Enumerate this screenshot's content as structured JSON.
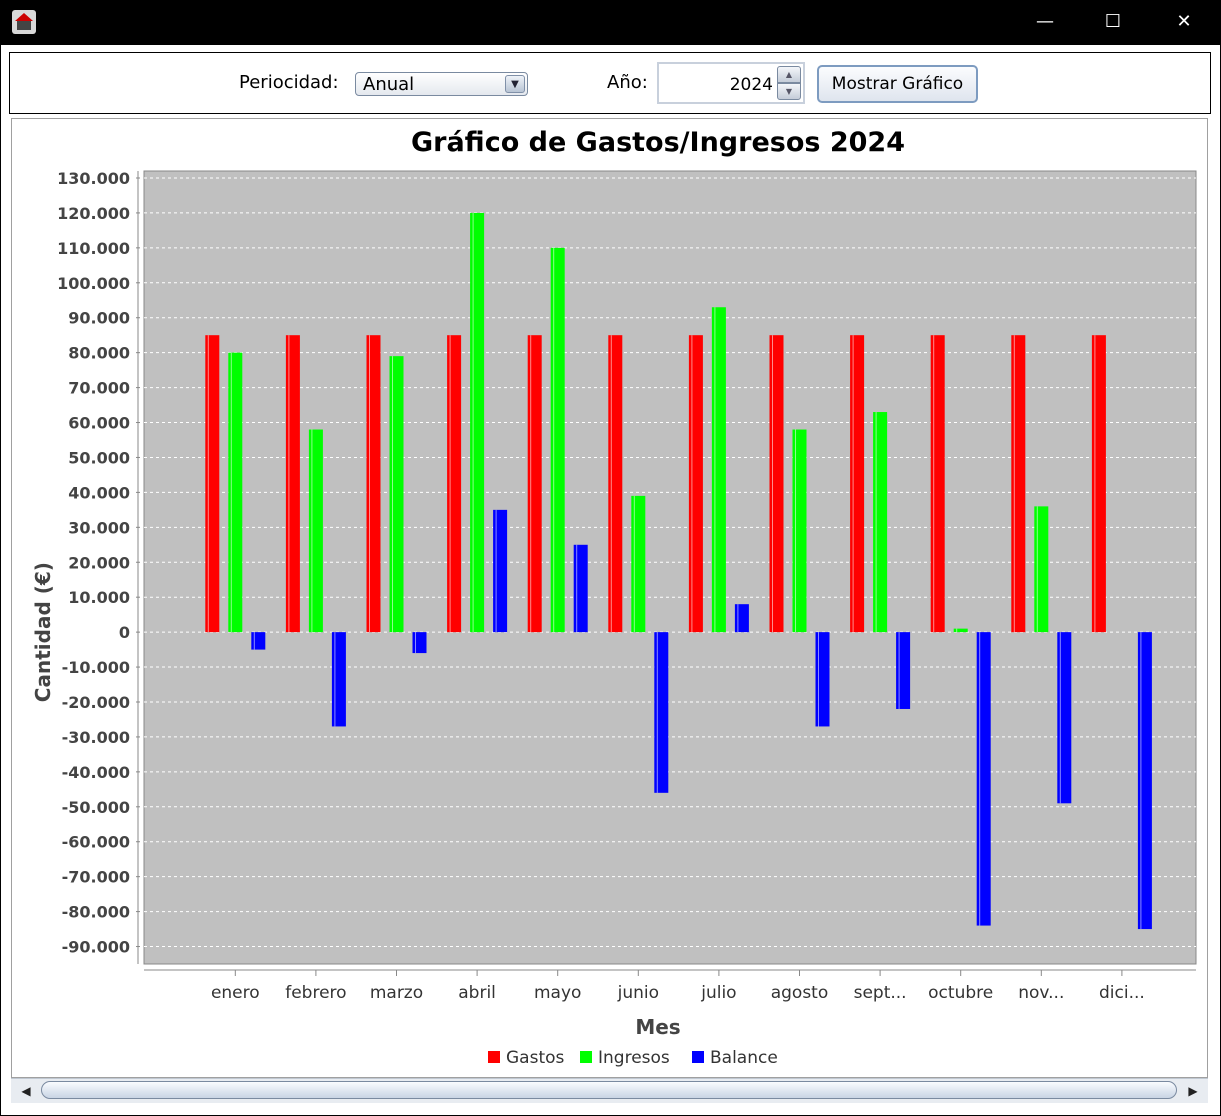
{
  "window": {
    "minimize_glyph": "—",
    "maximize_glyph": "☐",
    "close_glyph": "✕",
    "icon": "app-icon"
  },
  "toolbar": {
    "periodicidad_label": "Periocidad:",
    "periodicidad_value": "Anual",
    "anio_label": "Año:",
    "anio_value": "2024",
    "show_button": "Mostrar Gráfico"
  },
  "chart_data": {
    "type": "bar",
    "title": "Gráfico de Gastos/Ingresos 2024",
    "xlabel": "Mes",
    "ylabel": "Cantidad (€)",
    "ylim": [
      -95000,
      132000
    ],
    "yticks": [
      130000,
      120000,
      110000,
      100000,
      90000,
      80000,
      70000,
      60000,
      50000,
      40000,
      30000,
      20000,
      10000,
      0,
      -10000,
      -20000,
      -30000,
      -40000,
      -50000,
      -60000,
      -70000,
      -80000,
      -90000
    ],
    "ytick_labels": [
      "130.000",
      "120.000",
      "110.000",
      "100.000",
      "90.000",
      "80.000",
      "70.000",
      "60.000",
      "50.000",
      "40.000",
      "30.000",
      "20.000",
      "10.000",
      "0",
      "-10.000",
      "-20.000",
      "-30.000",
      "-40.000",
      "-50.000",
      "-60.000",
      "-70.000",
      "-80.000",
      "-90.000"
    ],
    "categories": [
      "enero",
      "febrero",
      "marzo",
      "abril",
      "mayo",
      "junio",
      "julio",
      "agosto",
      "sept...",
      "octubre",
      "nov...",
      "dici..."
    ],
    "grid": true,
    "legend_position": "bottom",
    "background": "#c0c0c0",
    "series": [
      {
        "name": "Gastos",
        "color": "#ff0000",
        "values": [
          85000,
          85000,
          85000,
          85000,
          85000,
          85000,
          85000,
          85000,
          85000,
          85000,
          85000,
          85000
        ]
      },
      {
        "name": "Ingresos",
        "color": "#00ff00",
        "values": [
          80000,
          58000,
          79000,
          120000,
          110000,
          39000,
          93000,
          58000,
          63000,
          1000,
          36000,
          0
        ]
      },
      {
        "name": "Balance",
        "color": "#0000ff",
        "values": [
          -5000,
          -27000,
          -6000,
          35000,
          25000,
          -46000,
          8000,
          -27000,
          -22000,
          -84000,
          -49000,
          -85000
        ]
      }
    ]
  }
}
